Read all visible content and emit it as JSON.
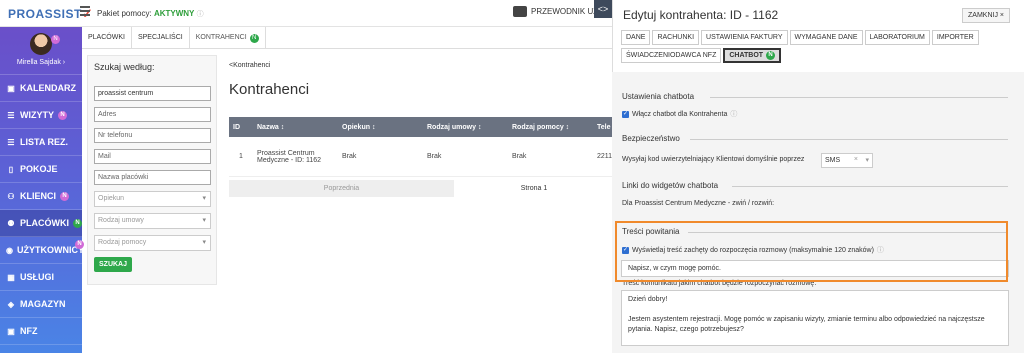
{
  "topbar": {
    "logo_text": "PROASSIST",
    "package_label": "Pakiet pomocy:",
    "package_status": "AKTYWNY",
    "guide_label": "PRZEWODNIK UŻ",
    "toggle_label": "<>"
  },
  "sidebar": {
    "username": "Mirella Sajdak ›",
    "avatar_badge": "N",
    "items": [
      {
        "label": "KALENDARZ",
        "icon": "calendar-icon"
      },
      {
        "label": "WIZYTY",
        "icon": "list-icon",
        "badge": "N",
        "badge_color": "#d16bd7"
      },
      {
        "label": "LISTA REZ.",
        "icon": "list-icon"
      },
      {
        "label": "POKOJE",
        "icon": "door-icon"
      },
      {
        "label": "KLIENCI",
        "icon": "people-icon",
        "badge": "N",
        "badge_color": "#d16bd7"
      },
      {
        "label": "PLACÓWKI",
        "icon": "building-icon",
        "badge": "N",
        "badge_color": "#2ea84b"
      },
      {
        "label": "UŻYTKOWNICY",
        "icon": "user-icon",
        "badge": "N",
        "badge_color": "#d16bd7"
      },
      {
        "label": "USŁUGI",
        "icon": "grid-icon"
      },
      {
        "label": "MAGAZYN",
        "icon": "box-icon"
      },
      {
        "label": "NFZ",
        "icon": "document-icon"
      }
    ]
  },
  "main_tabs": [
    "PLACÓWKI",
    "SPECJALIŚCI",
    "KONTRAHENCI"
  ],
  "main_tab_badge": "N",
  "filter": {
    "title": "Szukaj według:",
    "inputs": [
      "proassist centrum",
      "Adres",
      "Nr telefonu",
      "Mail",
      "Nazwa placówki"
    ],
    "selects": [
      "Opiekun",
      "Rodzaj umowy",
      "Rodzaj pomocy"
    ],
    "search_button": "SZUKAJ"
  },
  "content": {
    "breadcrumb": "<Kontrahenci",
    "title": "Kontrahenci",
    "columns": [
      "ID",
      "Nazwa ↕",
      "Opiekun ↕",
      "Rodzaj umowy ↕",
      "Rodzaj pomocy ↕",
      "Tele"
    ],
    "rows": [
      [
        "1",
        "Proassist Centrum Medyczne - ID: 1162",
        "Brak",
        "Brak",
        "Brak",
        "2211"
      ]
    ],
    "pager_prev": "Poprzednia",
    "pager_page": "Strona 1"
  },
  "panel": {
    "title": "Edytuj kontrahenta: ID - 1162",
    "close_label": "ZAMKNIJ ×",
    "tabs": [
      "DANE",
      "RACHUNKI",
      "USTAWIENIA FAKTURY",
      "WYMAGANE DANE",
      "LABORATORIUM",
      "IMPORTER",
      "ŚWIADCZENIODAWCA NFZ",
      "CHATBOT"
    ],
    "active_tab_badge": "N",
    "section_chatbot": "Ustawienia chatbota",
    "enable_chatbot": "Włącz chatbot dla Kontrahenta",
    "section_security": "Bezpieczeństwo",
    "security_text": "Wysyłaj kod uwierzytelniający Klientowi domyślnie poprzez",
    "security_value": "SMS",
    "section_links": "Linki do widgetów chatbota",
    "links_text": "Dla Proassist Centrum Medyczne - zwiń / rozwiń:",
    "section_welcome": "Treści powitania",
    "welcome_checkbox": "Wyświetlaj treść zachęty do rozpoczęcia rozmowy (maksymalnie 120 znaków)",
    "welcome_value": "Napisz, w czym mogę pomóc.",
    "message_label": "Treść komunikatu jakim chatbot będzie rozpoczynać rozmowę:",
    "message_line1": "Dzień dobry!",
    "message_line2": "Jestem asystentem rejestracji. Mogę pomóc w zapisaniu wizyty, zmianie terminu albo odpowiedzieć na najczęstsze pytania. Napisz, czego potrzebujesz?"
  },
  "colors": {
    "accent": "#2ea84b",
    "highlight": "#f08a2c",
    "sidebar_top": "#6a4fc9",
    "sidebar_bottom": "#4a84e6"
  }
}
